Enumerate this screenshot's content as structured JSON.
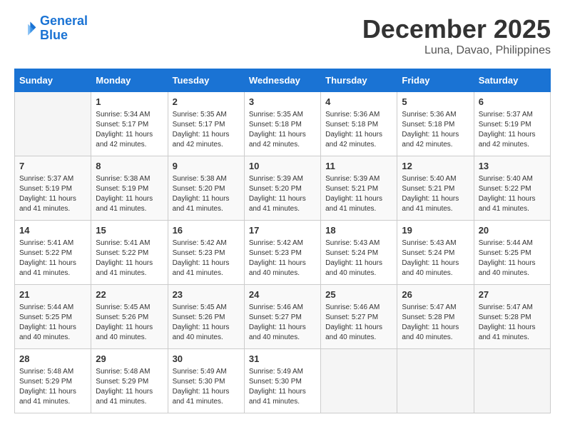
{
  "header": {
    "logo_line1": "General",
    "logo_line2": "Blue",
    "month": "December 2025",
    "location": "Luna, Davao, Philippines"
  },
  "days_of_week": [
    "Sunday",
    "Monday",
    "Tuesday",
    "Wednesday",
    "Thursday",
    "Friday",
    "Saturday"
  ],
  "weeks": [
    [
      {
        "day": "",
        "info": ""
      },
      {
        "day": "1",
        "info": "Sunrise: 5:34 AM\nSunset: 5:17 PM\nDaylight: 11 hours\nand 42 minutes."
      },
      {
        "day": "2",
        "info": "Sunrise: 5:35 AM\nSunset: 5:17 PM\nDaylight: 11 hours\nand 42 minutes."
      },
      {
        "day": "3",
        "info": "Sunrise: 5:35 AM\nSunset: 5:18 PM\nDaylight: 11 hours\nand 42 minutes."
      },
      {
        "day": "4",
        "info": "Sunrise: 5:36 AM\nSunset: 5:18 PM\nDaylight: 11 hours\nand 42 minutes."
      },
      {
        "day": "5",
        "info": "Sunrise: 5:36 AM\nSunset: 5:18 PM\nDaylight: 11 hours\nand 42 minutes."
      },
      {
        "day": "6",
        "info": "Sunrise: 5:37 AM\nSunset: 5:19 PM\nDaylight: 11 hours\nand 42 minutes."
      }
    ],
    [
      {
        "day": "7",
        "info": "Sunrise: 5:37 AM\nSunset: 5:19 PM\nDaylight: 11 hours\nand 41 minutes."
      },
      {
        "day": "8",
        "info": "Sunrise: 5:38 AM\nSunset: 5:19 PM\nDaylight: 11 hours\nand 41 minutes."
      },
      {
        "day": "9",
        "info": "Sunrise: 5:38 AM\nSunset: 5:20 PM\nDaylight: 11 hours\nand 41 minutes."
      },
      {
        "day": "10",
        "info": "Sunrise: 5:39 AM\nSunset: 5:20 PM\nDaylight: 11 hours\nand 41 minutes."
      },
      {
        "day": "11",
        "info": "Sunrise: 5:39 AM\nSunset: 5:21 PM\nDaylight: 11 hours\nand 41 minutes."
      },
      {
        "day": "12",
        "info": "Sunrise: 5:40 AM\nSunset: 5:21 PM\nDaylight: 11 hours\nand 41 minutes."
      },
      {
        "day": "13",
        "info": "Sunrise: 5:40 AM\nSunset: 5:22 PM\nDaylight: 11 hours\nand 41 minutes."
      }
    ],
    [
      {
        "day": "14",
        "info": "Sunrise: 5:41 AM\nSunset: 5:22 PM\nDaylight: 11 hours\nand 41 minutes."
      },
      {
        "day": "15",
        "info": "Sunrise: 5:41 AM\nSunset: 5:22 PM\nDaylight: 11 hours\nand 41 minutes."
      },
      {
        "day": "16",
        "info": "Sunrise: 5:42 AM\nSunset: 5:23 PM\nDaylight: 11 hours\nand 41 minutes."
      },
      {
        "day": "17",
        "info": "Sunrise: 5:42 AM\nSunset: 5:23 PM\nDaylight: 11 hours\nand 40 minutes."
      },
      {
        "day": "18",
        "info": "Sunrise: 5:43 AM\nSunset: 5:24 PM\nDaylight: 11 hours\nand 40 minutes."
      },
      {
        "day": "19",
        "info": "Sunrise: 5:43 AM\nSunset: 5:24 PM\nDaylight: 11 hours\nand 40 minutes."
      },
      {
        "day": "20",
        "info": "Sunrise: 5:44 AM\nSunset: 5:25 PM\nDaylight: 11 hours\nand 40 minutes."
      }
    ],
    [
      {
        "day": "21",
        "info": "Sunrise: 5:44 AM\nSunset: 5:25 PM\nDaylight: 11 hours\nand 40 minutes."
      },
      {
        "day": "22",
        "info": "Sunrise: 5:45 AM\nSunset: 5:26 PM\nDaylight: 11 hours\nand 40 minutes."
      },
      {
        "day": "23",
        "info": "Sunrise: 5:45 AM\nSunset: 5:26 PM\nDaylight: 11 hours\nand 40 minutes."
      },
      {
        "day": "24",
        "info": "Sunrise: 5:46 AM\nSunset: 5:27 PM\nDaylight: 11 hours\nand 40 minutes."
      },
      {
        "day": "25",
        "info": "Sunrise: 5:46 AM\nSunset: 5:27 PM\nDaylight: 11 hours\nand 40 minutes."
      },
      {
        "day": "26",
        "info": "Sunrise: 5:47 AM\nSunset: 5:28 PM\nDaylight: 11 hours\nand 40 minutes."
      },
      {
        "day": "27",
        "info": "Sunrise: 5:47 AM\nSunset: 5:28 PM\nDaylight: 11 hours\nand 41 minutes."
      }
    ],
    [
      {
        "day": "28",
        "info": "Sunrise: 5:48 AM\nSunset: 5:29 PM\nDaylight: 11 hours\nand 41 minutes."
      },
      {
        "day": "29",
        "info": "Sunrise: 5:48 AM\nSunset: 5:29 PM\nDaylight: 11 hours\nand 41 minutes."
      },
      {
        "day": "30",
        "info": "Sunrise: 5:49 AM\nSunset: 5:30 PM\nDaylight: 11 hours\nand 41 minutes."
      },
      {
        "day": "31",
        "info": "Sunrise: 5:49 AM\nSunset: 5:30 PM\nDaylight: 11 hours\nand 41 minutes."
      },
      {
        "day": "",
        "info": ""
      },
      {
        "day": "",
        "info": ""
      },
      {
        "day": "",
        "info": ""
      }
    ]
  ]
}
